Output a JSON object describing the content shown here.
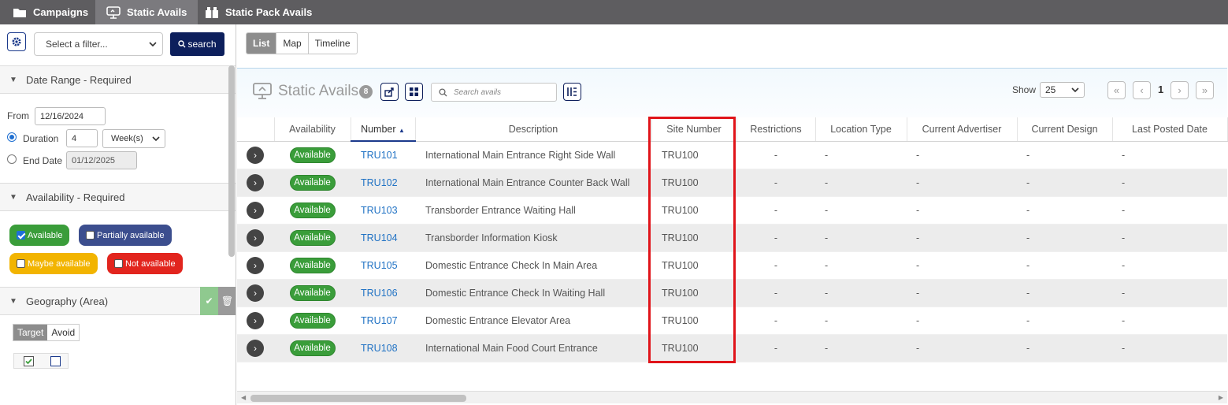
{
  "top_tabs": [
    {
      "label": "Campaigns",
      "icon": "folder-icon"
    },
    {
      "label": "Static Avails",
      "icon": "billboard-icon"
    },
    {
      "label": "Static Pack Avails",
      "icon": "pack-icon"
    }
  ],
  "sidebar": {
    "filter_placeholder": "Select a filter...",
    "search_label": "search",
    "date_range": {
      "title": "Date Range - Required",
      "from_label": "From",
      "from_value": "12/16/2024",
      "duration_label": "Duration",
      "duration_value": "4",
      "duration_unit": "Week(s)",
      "end_label": "End Date",
      "end_value": "01/12/2025"
    },
    "availability": {
      "title": "Availability - Required",
      "options": [
        {
          "label": "Available",
          "checked": true,
          "color": "#3a9d3a"
        },
        {
          "label": "Partially available",
          "checked": false,
          "color": "#3c4e8e"
        },
        {
          "label": "Maybe available",
          "checked": false,
          "color": "#f2b400"
        },
        {
          "label": "Not available",
          "checked": false,
          "color": "#e2251e"
        }
      ]
    },
    "geography": {
      "title": "Geography (Area)",
      "target_label": "Target",
      "avoid_label": "Avoid"
    }
  },
  "main": {
    "view_tabs": [
      "List",
      "Map",
      "Timeline"
    ],
    "title": "Static Avails",
    "count": "8",
    "search_placeholder": "Search avails",
    "show_label": "Show",
    "page_size": "25",
    "page_number": "1",
    "columns": [
      "",
      "Availability",
      "Number",
      "Description",
      "Site Number",
      "Restrictions",
      "Location Type",
      "Current Advertiser",
      "Current Design",
      "Last Posted Date"
    ],
    "rows": [
      {
        "availability": "Available",
        "number": "TRU101",
        "description": "International Main Entrance Right Side Wall",
        "site": "TRU100",
        "restrictions": "-",
        "location_type": "-",
        "advertiser": "-",
        "design": "-",
        "last_posted": "-"
      },
      {
        "availability": "Available",
        "number": "TRU102",
        "description": "International Main Entrance Counter Back Wall",
        "site": "TRU100",
        "restrictions": "-",
        "location_type": "-",
        "advertiser": "-",
        "design": "-",
        "last_posted": "-"
      },
      {
        "availability": "Available",
        "number": "TRU103",
        "description": "Transborder Entrance Waiting Hall",
        "site": "TRU100",
        "restrictions": "-",
        "location_type": "-",
        "advertiser": "-",
        "design": "-",
        "last_posted": "-"
      },
      {
        "availability": "Available",
        "number": "TRU104",
        "description": "Transborder Information Kiosk",
        "site": "TRU100",
        "restrictions": "-",
        "location_type": "-",
        "advertiser": "-",
        "design": "-",
        "last_posted": "-"
      },
      {
        "availability": "Available",
        "number": "TRU105",
        "description": "Domestic Entrance Check In Main Area",
        "site": "TRU100",
        "restrictions": "-",
        "location_type": "-",
        "advertiser": "-",
        "design": "-",
        "last_posted": "-"
      },
      {
        "availability": "Available",
        "number": "TRU106",
        "description": "Domestic Entrance Check In Waiting Hall",
        "site": "TRU100",
        "restrictions": "-",
        "location_type": "-",
        "advertiser": "-",
        "design": "-",
        "last_posted": "-"
      },
      {
        "availability": "Available",
        "number": "TRU107",
        "description": "Domestic Entrance Elevator Area",
        "site": "TRU100",
        "restrictions": "-",
        "location_type": "-",
        "advertiser": "-",
        "design": "-",
        "last_posted": "-"
      },
      {
        "availability": "Available",
        "number": "TRU108",
        "description": "International Main Food Court Entrance",
        "site": "TRU100",
        "restrictions": "-",
        "location_type": "-",
        "advertiser": "-",
        "design": "-",
        "last_posted": "-"
      }
    ]
  },
  "colors": {
    "navy": "#0d1f5c",
    "available_green": "#3a9d3a",
    "highlight_red": "#e0141a",
    "link_blue": "#2072c4"
  }
}
